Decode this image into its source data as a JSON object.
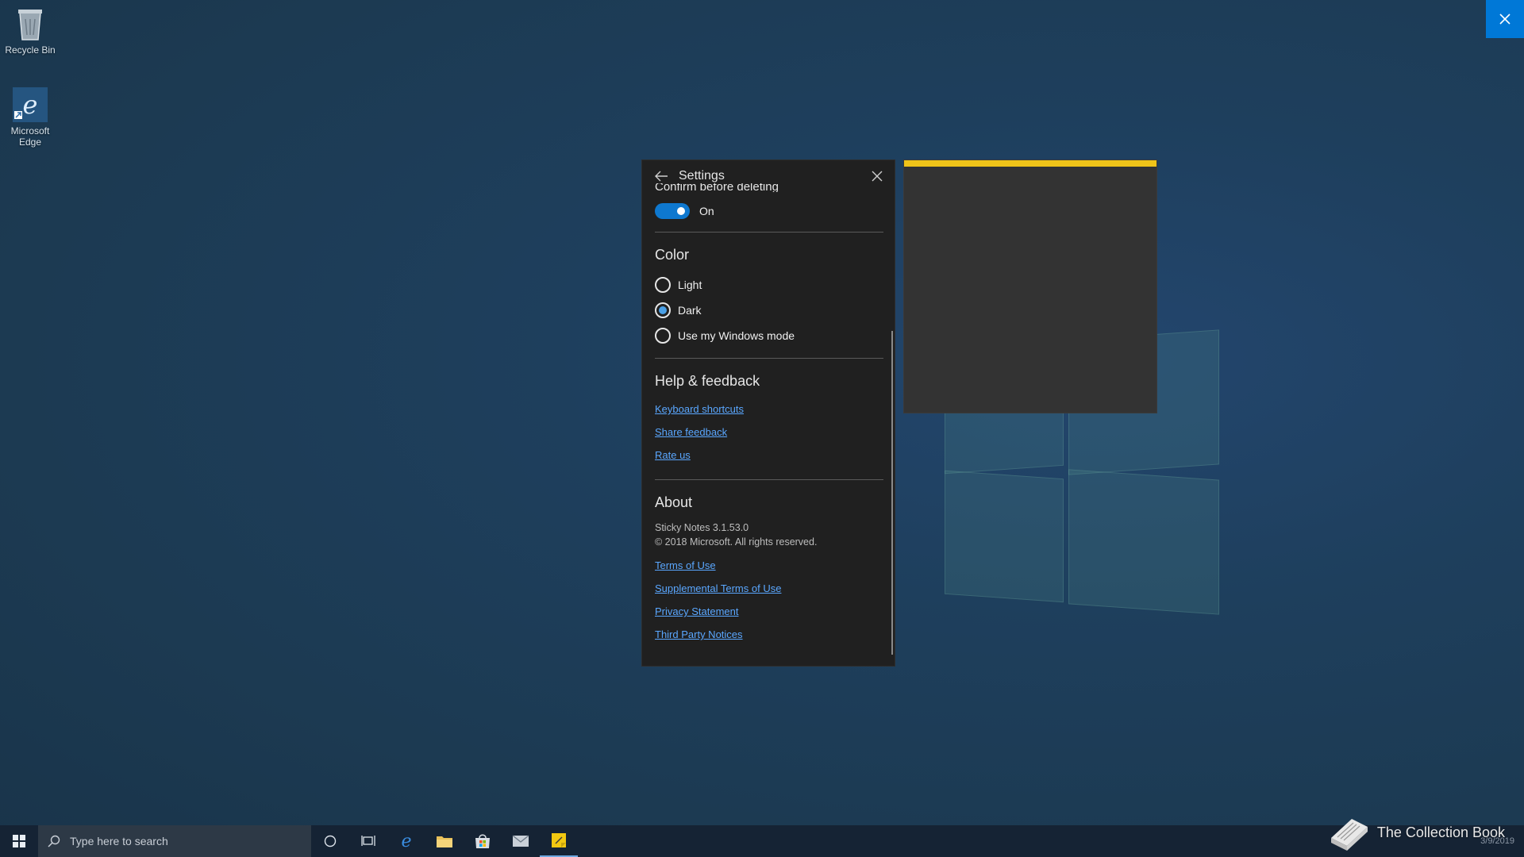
{
  "desktop": {
    "icons": [
      {
        "label": "Recycle Bin",
        "icon": "recycle-bin-icon"
      },
      {
        "label": "Microsoft Edge",
        "icon": "edge-icon"
      }
    ]
  },
  "settings": {
    "title": "Settings",
    "confirm_label": "Confirm before deleting",
    "toggle_state": "On",
    "color_section": {
      "title": "Color",
      "options": [
        {
          "label": "Light",
          "checked": false
        },
        {
          "label": "Dark",
          "checked": true
        },
        {
          "label": "Use my Windows mode",
          "checked": false
        }
      ]
    },
    "help_section": {
      "title": "Help & feedback",
      "links": [
        "Keyboard shortcuts",
        "Share feedback",
        "Rate us"
      ]
    },
    "about_section": {
      "title": "About",
      "version": "Sticky Notes 3.1.53.0",
      "copyright": "© 2018 Microsoft. All rights reserved.",
      "links": [
        "Terms of Use",
        "Supplemental Terms of Use",
        "Privacy Statement",
        "Third Party Notices"
      ]
    }
  },
  "note": {
    "accent_color": "#f0c419"
  },
  "taskbar": {
    "search_placeholder": "Type here to search",
    "date": "3/9/2019"
  },
  "watermark": {
    "text": "The Collection Book"
  },
  "colors": {
    "accent": "#0078d7",
    "link": "#5aa7ff",
    "toggle_on": "#0e78cf",
    "note_bar": "#f0c419"
  }
}
